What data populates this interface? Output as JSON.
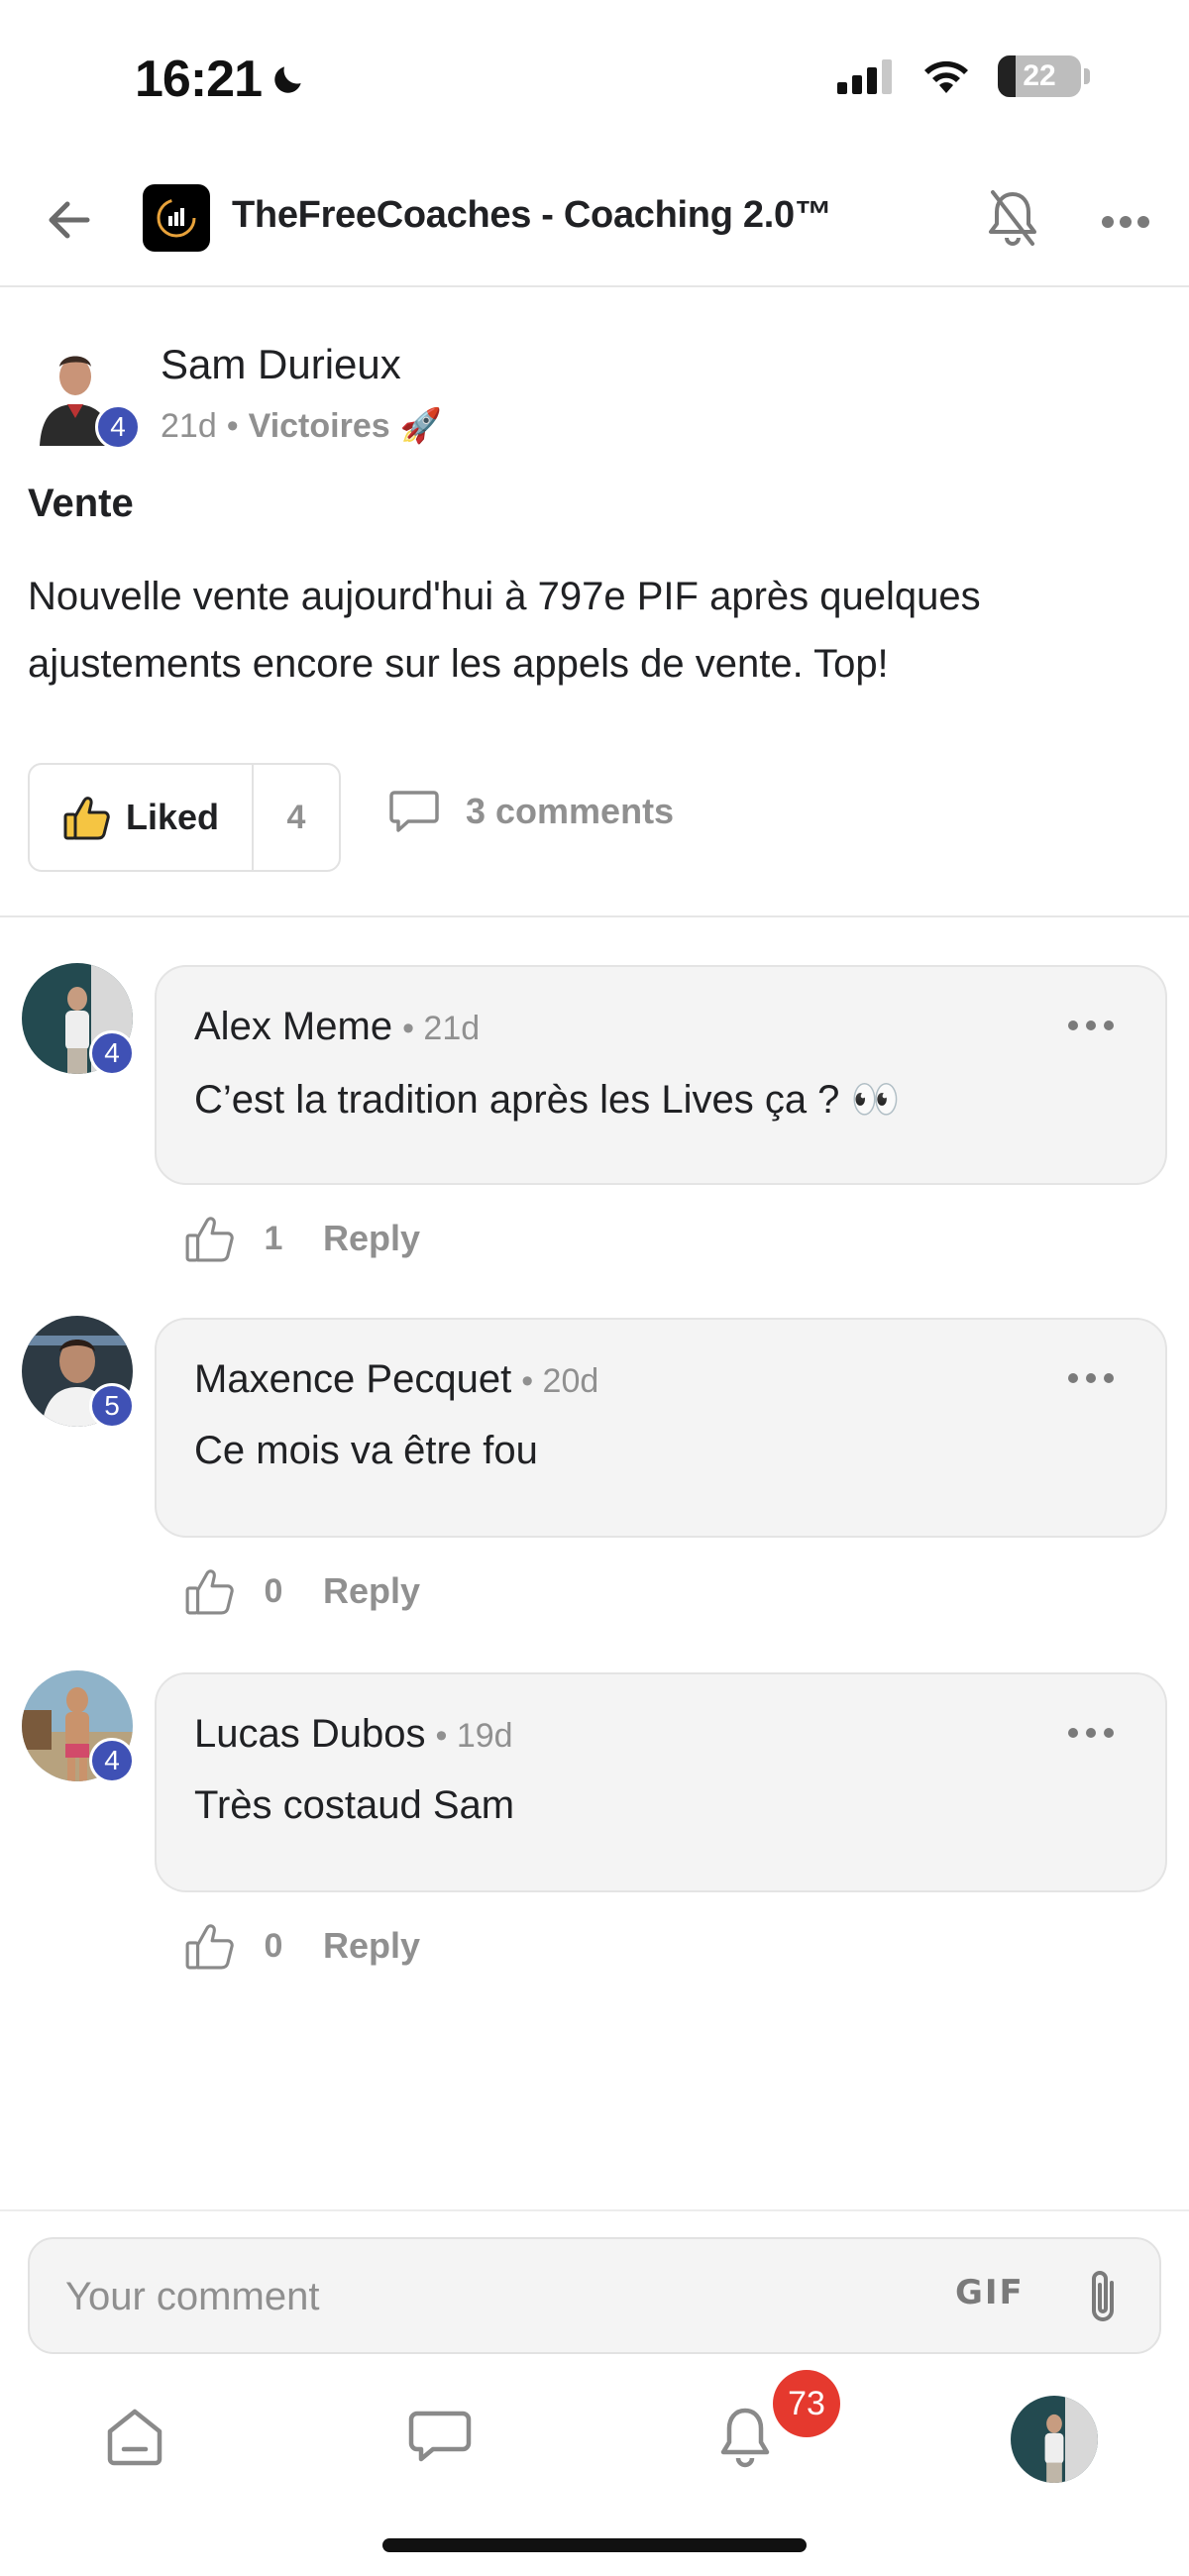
{
  "status_bar": {
    "time": "16:21",
    "battery_percent": "22",
    "battery_level": 0.22
  },
  "header": {
    "group_title": "TheFreeCoaches - Coaching 2.0™"
  },
  "post": {
    "author": "Sam Durieux",
    "author_level": "4",
    "age": "21d",
    "separator": "•",
    "category": "Victoires",
    "category_emoji": "🚀",
    "title": "Vente",
    "body": "Nouvelle vente aujourd'hui à 797e PIF après quelques ajustements encore sur les appels de vente. Top!",
    "like_label": "Liked",
    "like_count": "4",
    "comments_label": "3 comments"
  },
  "comments": [
    {
      "author": "Alex Meme",
      "level": "4",
      "time": "• 21d",
      "text": "C’est la tradition après les Lives ça ? 👀",
      "likes": "1",
      "reply_label": "Reply"
    },
    {
      "author": "Maxence Pecquet",
      "level": "5",
      "time": "• 20d",
      "text": "Ce mois va être fou",
      "likes": "0",
      "reply_label": "Reply"
    },
    {
      "author": "Lucas Dubos",
      "level": "4",
      "time": "• 19d",
      "text": "Très costaud Sam",
      "likes": "0",
      "reply_label": "Reply"
    }
  ],
  "composer": {
    "placeholder": "Your comment",
    "gif_label": "GIF"
  },
  "bottom_nav": {
    "notification_count": "73"
  },
  "colors": {
    "level_badge": "#3f51b5",
    "notification_badge": "#e5392e",
    "muted_text": "#909090"
  }
}
